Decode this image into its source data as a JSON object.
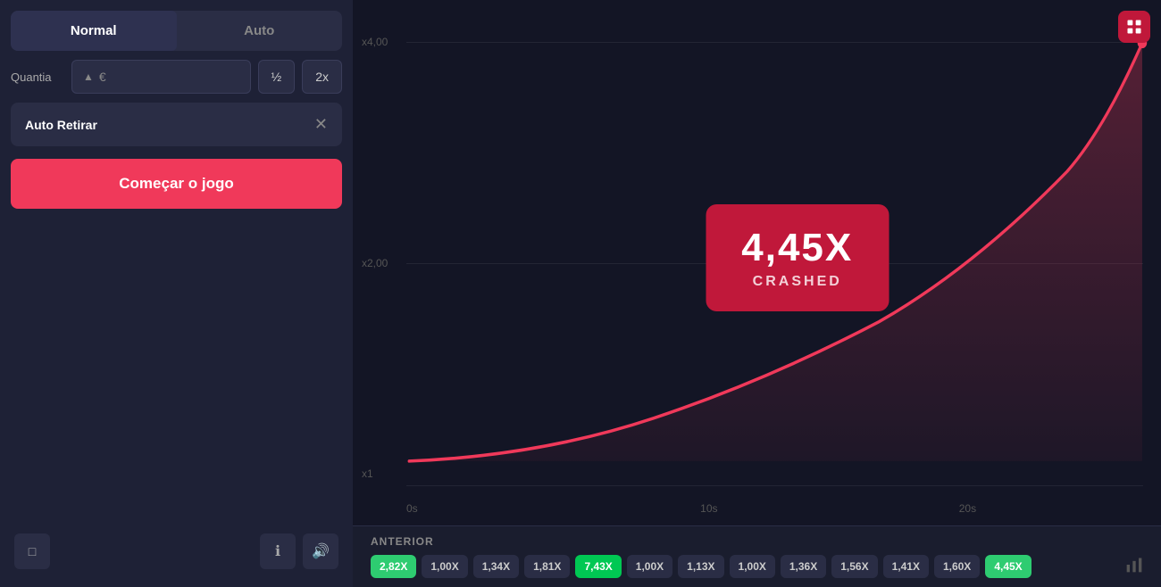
{
  "leftPanel": {
    "modes": [
      {
        "label": "Normal",
        "active": true
      },
      {
        "label": "Auto",
        "active": false
      }
    ],
    "amountLabel": "Quantia",
    "amountValue": "",
    "euroSymbol": "€",
    "halfLabel": "½",
    "doubleLabel": "2x",
    "autoWithdrawLabel": "Auto Retirar",
    "startButtonLabel": "Começar o jogo"
  },
  "chart": {
    "yLabels": [
      "x4,00",
      "x2,00",
      "x1"
    ],
    "xLabels": [
      "0s",
      "10s",
      "20s"
    ],
    "crashValue": "4,45X",
    "crashedLabel": "CRASHED"
  },
  "previousSection": {
    "label": "ANTERIOR",
    "results": [
      {
        "value": "2,82X",
        "type": "green"
      },
      {
        "value": "1,00X",
        "type": "gray"
      },
      {
        "value": "1,34X",
        "type": "gray"
      },
      {
        "value": "1,81X",
        "type": "gray"
      },
      {
        "value": "7,43X",
        "type": "bright-green"
      },
      {
        "value": "1,00X",
        "type": "gray"
      },
      {
        "value": "1,13X",
        "type": "gray"
      },
      {
        "value": "1,00X",
        "type": "gray"
      },
      {
        "value": "1,36X",
        "type": "gray"
      },
      {
        "value": "1,56X",
        "type": "gray"
      },
      {
        "value": "1,41X",
        "type": "gray"
      },
      {
        "value": "1,60X",
        "type": "gray"
      },
      {
        "value": "4,45X",
        "type": "green"
      }
    ]
  },
  "bottomIcons": {
    "fullscreenIcon": "⛶",
    "infoIcon": "ℹ",
    "soundIcon": "🔊"
  }
}
